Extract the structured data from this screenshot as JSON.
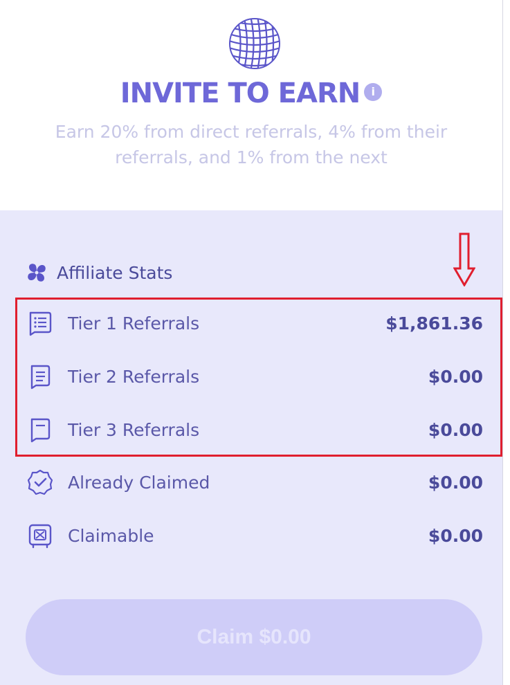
{
  "header": {
    "title": "INVITE TO EARN",
    "info_icon": "i",
    "subtitle": "Earn 20% from direct referrals, 4% from their referrals, and 1% from the next"
  },
  "stats": {
    "heading": "Affiliate Stats",
    "rows": [
      {
        "label": "Tier 1 Referrals",
        "value": "$1,861.36",
        "icon": "list-document-icon"
      },
      {
        "label": "Tier 2 Referrals",
        "value": "$0.00",
        "icon": "document-lines-icon"
      },
      {
        "label": "Tier 3 Referrals",
        "value": "$0.00",
        "icon": "document-line-icon"
      },
      {
        "label": "Already Claimed",
        "value": "$0.00",
        "icon": "check-badge-icon"
      },
      {
        "label": "Claimable",
        "value": "$0.00",
        "icon": "safe-icon"
      }
    ]
  },
  "claim_button": {
    "label": "Claim $0.00"
  },
  "colors": {
    "accent": "#6e68d8",
    "panel": "#e8e8fb",
    "highlight": "#e01e2e"
  }
}
